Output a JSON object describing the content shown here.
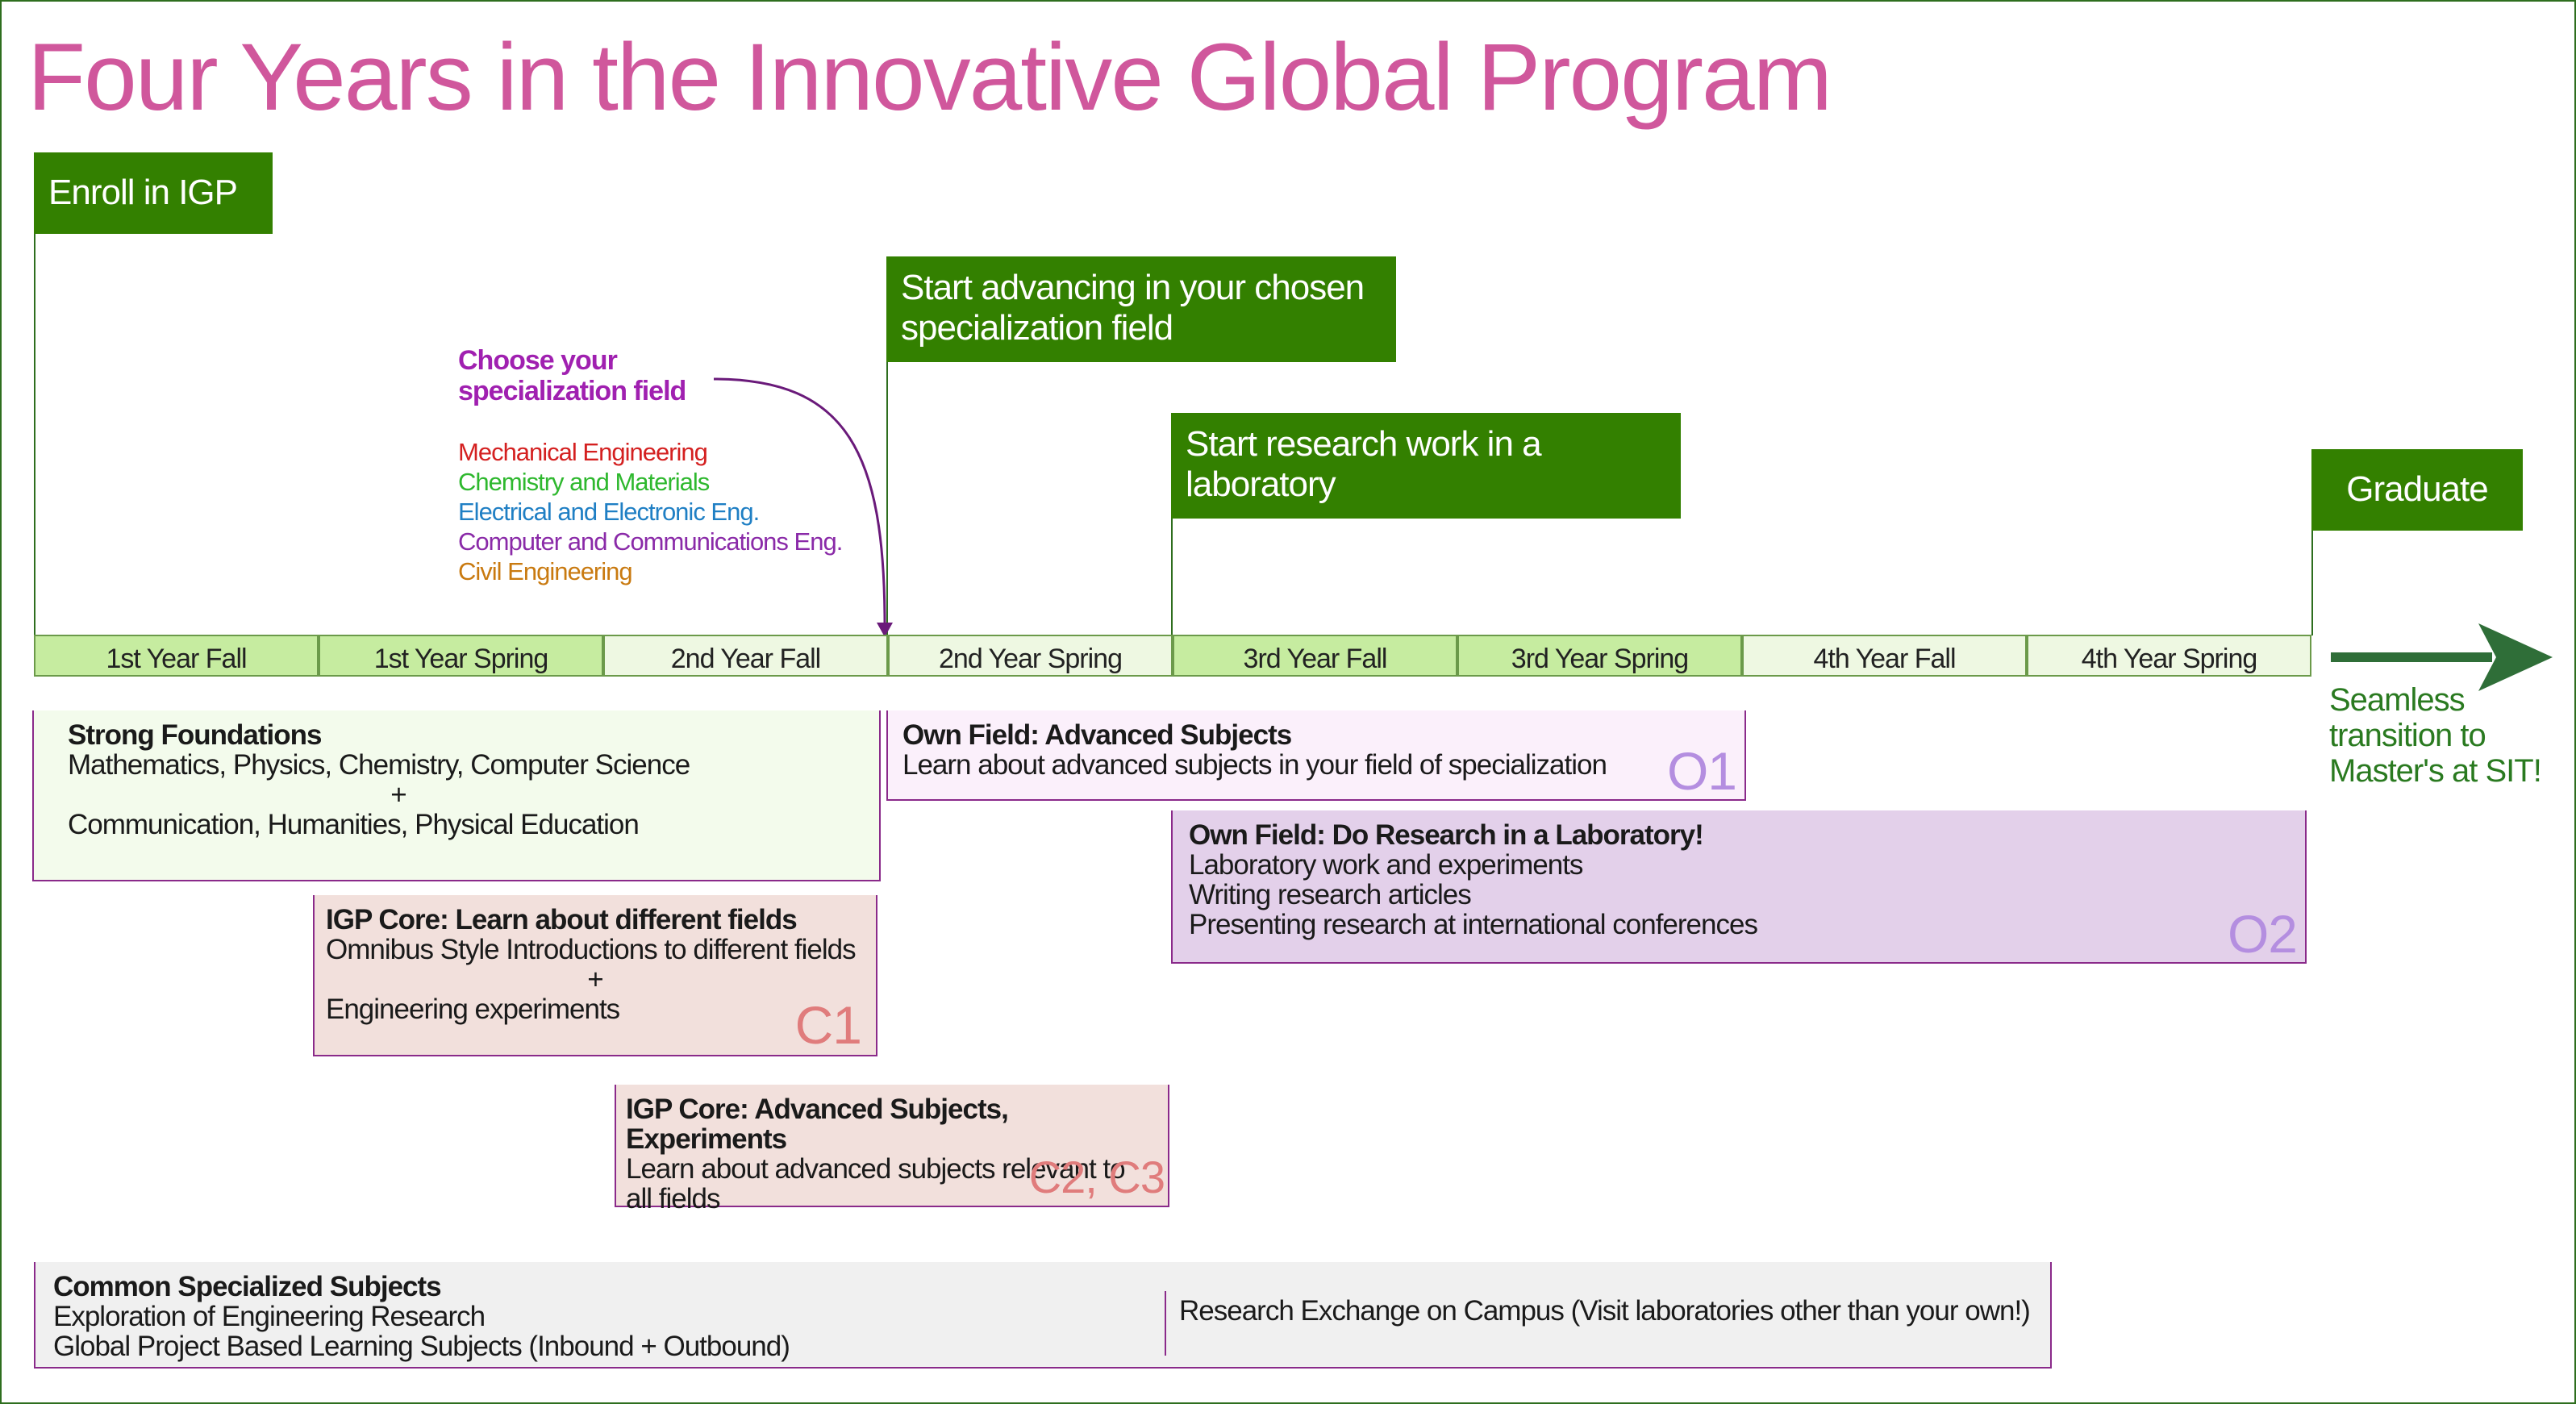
{
  "title": "Four Years in the Innovative Global Program",
  "milestones": {
    "enroll": "Enroll in IGP",
    "specialize": "Start advancing in your chosen specialization field",
    "research": "Start research work in a laboratory",
    "graduate": "Graduate"
  },
  "choose": {
    "heading": "Choose your specialization field",
    "fields": [
      {
        "label": "Mechanical Engineering",
        "color": "#d42020"
      },
      {
        "label": "Chemistry and Materials",
        "color": "#2eb82e"
      },
      {
        "label": "Electrical and Electronic Eng.",
        "color": "#1f7fc4"
      },
      {
        "label": "Computer and Communications Eng.",
        "color": "#8a2aa8"
      },
      {
        "label": "Civil Engineering",
        "color": "#c97a10"
      }
    ]
  },
  "semesters": [
    "1st Year Fall",
    "1st Year Spring",
    "2nd Year Fall",
    "2nd Year Spring",
    "3rd Year Fall",
    "3rd Year Spring",
    "4th Year Fall",
    "4th Year Spring"
  ],
  "seamless": "Seamless transition to Master's at SIT!",
  "boxes": {
    "foundations": {
      "heading": "Strong Foundations",
      "line1": "Mathematics, Physics, Chemistry, Computer Science",
      "plus": "+",
      "line2": "Communication, Humanities,  Physical  Education"
    },
    "c1": {
      "heading": "IGP Core: Learn about different fields",
      "line1": "Omnibus Style Introductions to different fields",
      "plus": "+",
      "line2": "Engineering experiments",
      "tag": "C1"
    },
    "c23": {
      "heading": "IGP Core: Advanced Subjects, Experiments",
      "line1": "Learn about advanced subjects relevant to",
      "line2": "all fields",
      "tag": "C2, C3"
    },
    "o1": {
      "heading": "Own Field: Advanced Subjects",
      "line1": "Learn about advanced subjects in your field of specialization",
      "tag": "O1"
    },
    "o2": {
      "heading": "Own Field: Do Research in a Laboratory!",
      "line1": "Laboratory work and experiments",
      "line2": "Writing research articles",
      "line3": "Presenting research at international conferences",
      "tag": "O2"
    },
    "common": {
      "heading": "Common Specialized Subjects",
      "line1": "Exploration of Engineering Research",
      "line2": "Global Project Based Learning Subjects (Inbound + Outbound)",
      "exchange": "Research Exchange on Campus (Visit laboratories other than your own!)"
    }
  }
}
